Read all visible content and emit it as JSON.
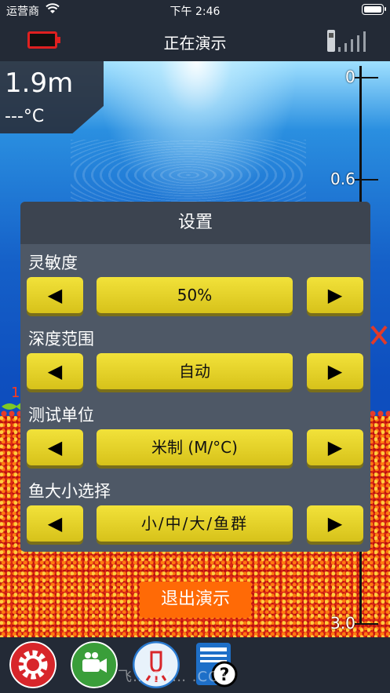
{
  "status_bar": {
    "carrier": "运营商",
    "time": "下午 2:46"
  },
  "nav": {
    "title": "正在演示"
  },
  "readout": {
    "depth": "1.9m",
    "temperature": "---°C"
  },
  "scale": {
    "labels": [
      "0",
      "0.6",
      "3.0"
    ],
    "fish_count": "1"
  },
  "settings": {
    "title": "设置",
    "rows": [
      {
        "label": "灵敏度",
        "value": "50%"
      },
      {
        "label": "深度范围",
        "value": "自动"
      },
      {
        "label": "测试单位",
        "value": "米制 (M/°C)"
      },
      {
        "label": "鱼大小选择",
        "value": "小/中/大/鱼群"
      }
    ]
  },
  "exit_label": "退出演示",
  "watermark": "飞… BY… .COM",
  "icons": [
    "wifi-icon",
    "battery-low-icon",
    "signal-icon",
    "left-arrow-icon",
    "right-arrow-icon",
    "settings-gear-icon",
    "camera-icon",
    "light-icon",
    "help-manual-icon"
  ],
  "colors": {
    "accent_yellow": "#e8d62a",
    "exit_orange": "#ff6a06",
    "battery_red": "#e02020"
  }
}
